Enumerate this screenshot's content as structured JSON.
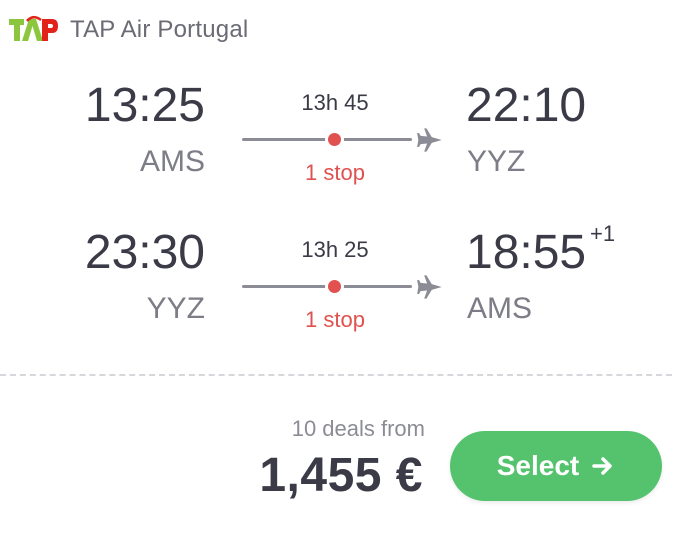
{
  "airline": {
    "name": "TAP Air Portugal",
    "logo_text": "TAP",
    "logo_colors": {
      "green": "#8cc63f",
      "red": "#e2231a"
    }
  },
  "legs": [
    {
      "departure_time": "13:25",
      "departure_code": "AMS",
      "duration": "13h 45",
      "stops": "1 stop",
      "arrival_time": "22:10",
      "arrival_code": "YYZ",
      "day_offset": ""
    },
    {
      "departure_time": "23:30",
      "departure_code": "YYZ",
      "duration": "13h 25",
      "stops": "1 stop",
      "arrival_time": "18:55",
      "arrival_code": "AMS",
      "day_offset": "+1"
    }
  ],
  "pricing": {
    "deals_text": "10 deals from",
    "price": "1,455 €"
  },
  "actions": {
    "select_label": "Select"
  },
  "colors": {
    "accent_green": "#55c36e",
    "stop_red": "#e0514f",
    "text_dark": "#3a3b47",
    "text_muted": "#7c7d86"
  },
  "icons": {
    "plane": "airplane-icon",
    "arrow": "arrow-right-icon",
    "stop": "stop-dot"
  }
}
